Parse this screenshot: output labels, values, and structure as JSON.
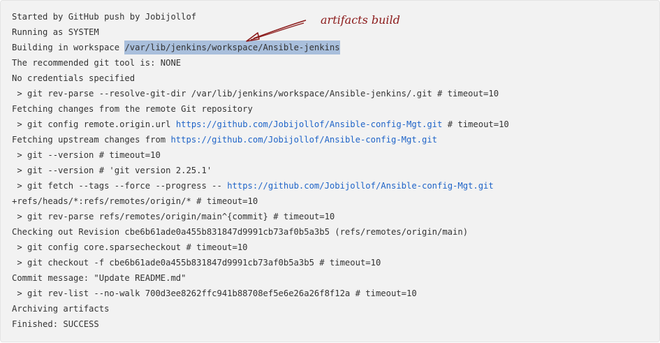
{
  "annotation": {
    "text": "artifacts build",
    "color": "#8b1a1a"
  },
  "colors": {
    "background": "#f2f2f2",
    "text": "#333333",
    "link": "#1f64c8",
    "highlight": "#a9bfdc"
  },
  "console": {
    "lines": [
      {
        "text": "Started by GitHub push by Jobijollof"
      },
      {
        "text": "Running as SYSTEM"
      },
      {
        "text": "Building in workspace ",
        "highlight": "/var/lib/jenkins/workspace/Ansible-jenkins"
      },
      {
        "text": "The recommended git tool is: NONE"
      },
      {
        "text": "No credentials specified"
      },
      {
        "text": " > git rev-parse --resolve-git-dir /var/lib/jenkins/workspace/Ansible-jenkins/.git # timeout=10"
      },
      {
        "text": "Fetching changes from the remote Git repository"
      },
      {
        "text": " > git config remote.origin.url ",
        "link": "https://github.com/Jobijollof/Ansible-config-Mgt.git",
        "after": " # timeout=10"
      },
      {
        "text": "Fetching upstream changes from ",
        "link": "https://github.com/Jobijollof/Ansible-config-Mgt.git"
      },
      {
        "text": " > git --version # timeout=10"
      },
      {
        "text": " > git --version # 'git version 2.25.1'"
      },
      {
        "text": " > git fetch --tags --force --progress -- ",
        "link": "https://github.com/Jobijollof/Ansible-config-Mgt.git"
      },
      {
        "text": "+refs/heads/*:refs/remotes/origin/* # timeout=10"
      },
      {
        "text": " > git rev-parse refs/remotes/origin/main^{commit} # timeout=10"
      },
      {
        "text": "Checking out Revision cbe6b61ade0a455b831847d9991cb73af0b5a3b5 (refs/remotes/origin/main)"
      },
      {
        "text": " > git config core.sparsecheckout # timeout=10"
      },
      {
        "text": " > git checkout -f cbe6b61ade0a455b831847d9991cb73af0b5a3b5 # timeout=10"
      },
      {
        "text": "Commit message: \"Update README.md\""
      },
      {
        "text": " > git rev-list --no-walk 700d3ee8262ffc941b88708ef5e6e26a26f8f12a # timeout=10"
      },
      {
        "text": "Archiving artifacts"
      },
      {
        "text": "Finished: SUCCESS"
      }
    ]
  }
}
